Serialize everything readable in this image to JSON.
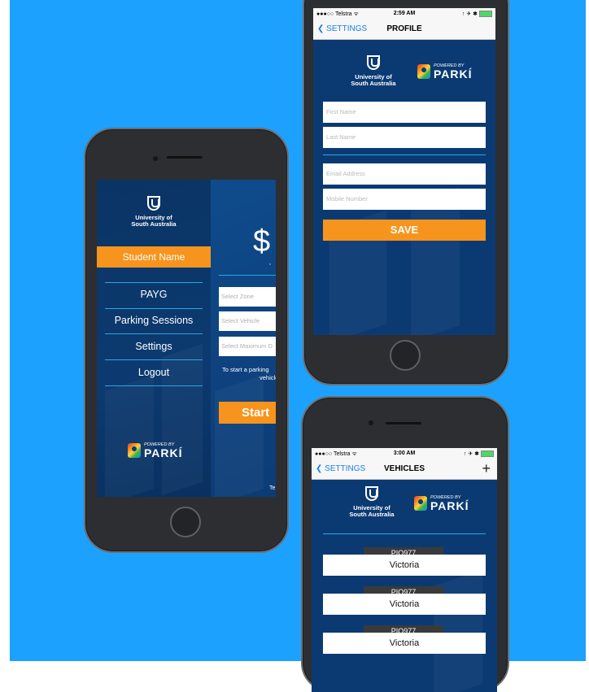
{
  "menu_phone": {
    "university": {
      "line1": "University of",
      "line2": "South Australia"
    },
    "student_name": "Student Name",
    "menu_items": [
      "PAYG",
      "Parking Sessions",
      "Settings",
      "Logout"
    ],
    "powered_by": "POWERED BY",
    "brand": "PARKÍ",
    "peek": {
      "dollar": "$",
      "star": "*",
      "inputs": [
        "Select Zone",
        "Select Vehicle",
        "Select Maximum D"
      ],
      "info_line1": "To start a parking",
      "info_line2": "vehicle",
      "start_button": "Start",
      "footer_fragment": "Te"
    }
  },
  "profile_phone": {
    "status": {
      "carrier": "●●●○○ Telstra ᯤ",
      "time": "2:59 AM",
      "right": "↑ ✈ ✱"
    },
    "nav": {
      "back": "SETTINGS",
      "title": "PROFILE"
    },
    "university": {
      "line1": "University of",
      "line2": "South Australia"
    },
    "powered_by": "POWERED BY",
    "brand": "PARKÍ",
    "fields": {
      "first_name": "First Name",
      "last_name": "Last Name",
      "email": "Email Address",
      "mobile": "Mobile Number"
    },
    "save_button": "SAVE"
  },
  "vehicles_phone": {
    "status": {
      "carrier": "●●●○○ Telstra ᯤ",
      "time": "3:00 AM",
      "right": "↑ ✈ ✱"
    },
    "nav": {
      "back": "SETTINGS",
      "title": "VEHICLES",
      "add": "+"
    },
    "university": {
      "line1": "University of",
      "line2": "South Australia"
    },
    "powered_by": "POWERED BY",
    "brand": "PARKÍ",
    "vehicles": [
      {
        "plate": "PIQ977",
        "state": "Victoria"
      },
      {
        "plate": "PIQ977",
        "state": "Victoria"
      },
      {
        "plate": "PIQ977",
        "state": "Victoria"
      }
    ]
  },
  "colors": {
    "background": "#1da1ff",
    "accent": "#f7941d",
    "screen": "#0b3a73",
    "divider": "#2aa7e0"
  }
}
